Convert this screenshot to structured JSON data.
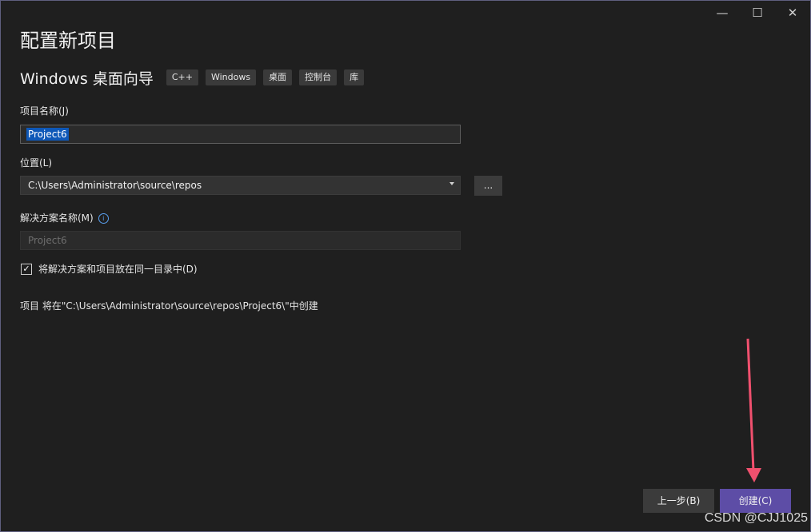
{
  "window": {
    "title": "配置新项目",
    "controls": {
      "minimize": "—",
      "maximize": "☐",
      "close": "✕"
    }
  },
  "template": {
    "name": "Windows 桌面向导",
    "tags": [
      "C++",
      "Windows",
      "桌面",
      "控制台",
      "库"
    ]
  },
  "project_name": {
    "label": "项目名称(J)",
    "value": "Project6"
  },
  "location": {
    "label": "位置(L)",
    "value": "C:\\Users\\Administrator\\source\\repos",
    "browse_label": "..."
  },
  "solution_name": {
    "label": "解决方案名称(M)",
    "value": "Project6"
  },
  "same_dir_checkbox": {
    "label": "将解决方案和项目放在同一目录中(D)",
    "checked": true
  },
  "path_info": "项目 将在\"C:\\Users\\Administrator\\source\\repos\\Project6\\\"中创建",
  "buttons": {
    "back": "上一步(B)",
    "create": "创建(C)"
  },
  "watermark": "CSDN @CJJ1025",
  "colors": {
    "accent": "#5d4da6",
    "selection": "#0e58b8",
    "annotation_arrow": "#f0506e"
  }
}
